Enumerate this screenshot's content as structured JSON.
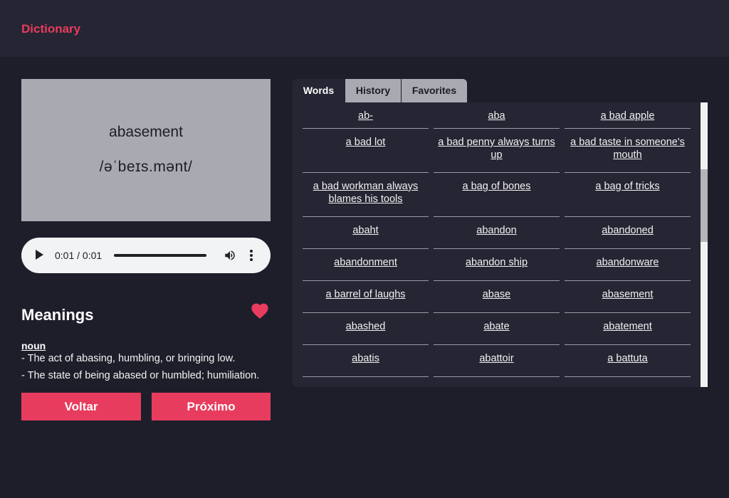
{
  "header": {
    "brand": "Dictionary"
  },
  "word_card": {
    "word": "abasement",
    "phonetic": "/əˈbeɪs.mənt/"
  },
  "audio": {
    "time": "0:01 / 0:01",
    "progress": 1.0
  },
  "meanings": {
    "title": "Meanings",
    "favorited": true,
    "part_of_speech": "noun",
    "definitions": [
      "- The act of abasing, humbling, or bringing low.",
      "- The state of being abased or humbled; humiliation."
    ]
  },
  "navigation": {
    "back_label": "Voltar",
    "next_label": "Próximo"
  },
  "tabs": [
    {
      "label": "Words",
      "active": true
    },
    {
      "label": "History",
      "active": false
    },
    {
      "label": "Favorites",
      "active": false
    }
  ],
  "word_list": [
    [
      "ab-",
      "aba",
      "a bad apple"
    ],
    [
      "a bad lot",
      "a bad penny always turns up",
      "a bad taste in someone's mouth"
    ],
    [
      "a bad workman always blames his tools",
      "a bag of bones",
      "a bag of tricks"
    ],
    [
      "abaht",
      "abandon",
      "abandoned"
    ],
    [
      "abandonment",
      "abandon ship",
      "abandonware"
    ],
    [
      "a barrel of laughs",
      "abase",
      "abasement"
    ],
    [
      "abashed",
      "abate",
      "abatement"
    ],
    [
      "abatis",
      "abattoir",
      "a battuta"
    ]
  ],
  "colors": {
    "accent": "#e83c5e",
    "background": "#1e1e2b",
    "panel": "#252533",
    "card": "#a9a9b1"
  }
}
